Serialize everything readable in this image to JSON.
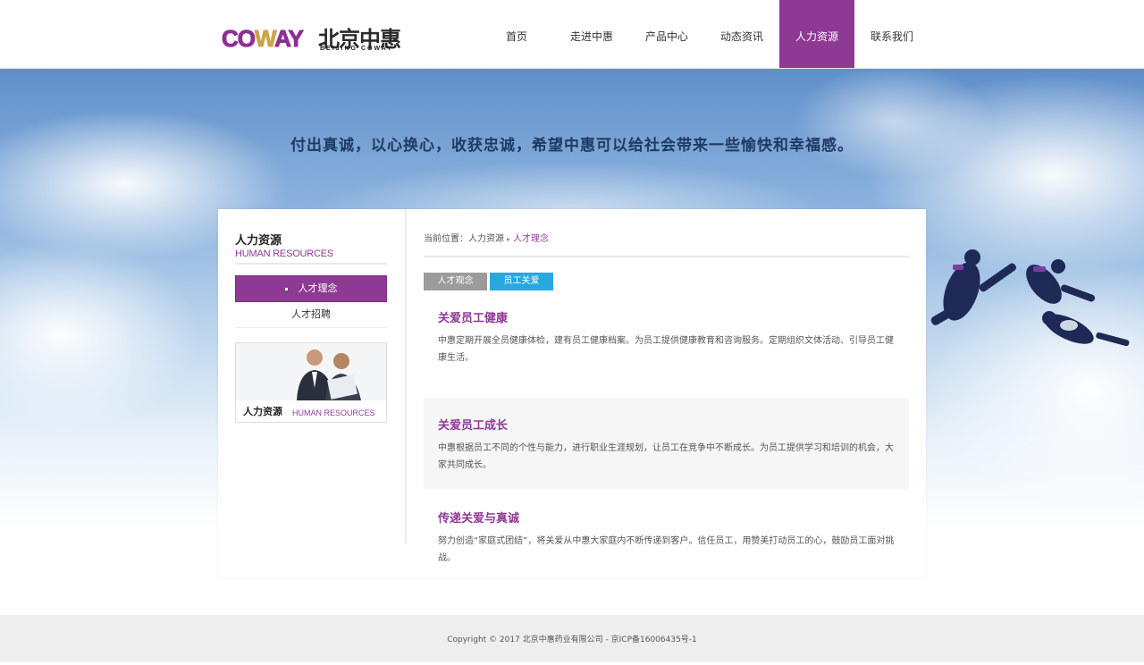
{
  "brand": {
    "logo_latin_1": "CO",
    "logo_latin_w": "W",
    "logo_latin_2": "AY",
    "logo_cn": "北京中惠",
    "logo_sub": "BEIJING COWAY",
    "primary_color": "#8e3a94",
    "blue_accent": "#29a8e0"
  },
  "nav": {
    "items": [
      {
        "label": "首页"
      },
      {
        "label": "走进中惠"
      },
      {
        "label": "产品中心"
      },
      {
        "label": "动态资讯"
      },
      {
        "label": "人力资源",
        "active": true
      },
      {
        "label": "联系我们"
      }
    ]
  },
  "banner": {
    "slogan": "付出真诚，以心换心，收获忠诚，希望中惠可以给社会带来一些愉快和幸福感。"
  },
  "sidebar": {
    "title_cn": "人力资源",
    "title_en": "HUMAN RESOURCES",
    "items": [
      {
        "label": "人才理念",
        "active": true
      },
      {
        "label": "人才招聘"
      }
    ],
    "ad_caption_cn": "人力资源",
    "ad_caption_en": "HUMAN RESOURCES"
  },
  "breadcrumb": {
    "prefix": "当前位置：",
    "level1": "人力资源",
    "separator": "▸",
    "current": "人才理念"
  },
  "tabs": [
    {
      "label": "人才观念"
    },
    {
      "label": "员工关爱",
      "active": true
    }
  ],
  "sections": [
    {
      "title": "关爱员工健康",
      "body": "中惠定期开展全员健康体检，建有员工健康档案。为员工提供健康教育和咨询服务。定期组织文体活动、引导员工健康生活。"
    },
    {
      "title": "关爱员工成长",
      "body": "中惠根据员工不同的个性与能力，进行职业生涯规划，让员工在竞争中不断成长。为员工提供学习和培训的机会，大家共同成长。"
    },
    {
      "title": "传递关爱与真诚",
      "body": "努力创造“家庭式团结”，将关爱从中惠大家庭内不断传递到客户。信任员工，用赞美打动员工的心，鼓励员工面对挑战。"
    }
  ],
  "footer": {
    "text": "Copyright © 2017 北京中惠药业有限公司 - 京ICP备16006435号-1"
  }
}
